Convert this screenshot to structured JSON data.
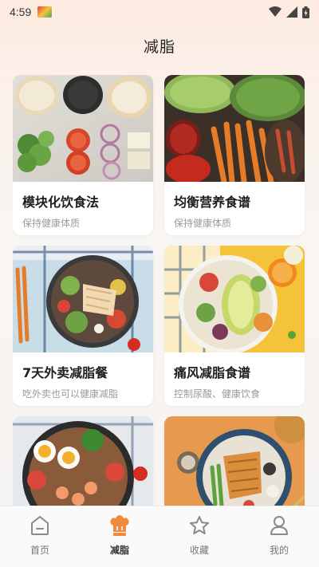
{
  "status": {
    "time": "4:59"
  },
  "header": {
    "title": "减脂"
  },
  "cards": [
    {
      "title": "模块化饮食法",
      "subtitle": "保持健康体质"
    },
    {
      "title": "均衡营养食谱",
      "subtitle": "保持健康体质"
    },
    {
      "title": "7天外卖减脂餐",
      "subtitle": "吃外卖也可以健康减脂"
    },
    {
      "title": "痛风减脂食谱",
      "subtitle": "控制尿酸、健康饮食"
    },
    {
      "title": "",
      "subtitle": ""
    },
    {
      "title": "",
      "subtitle": ""
    }
  ],
  "tabs": [
    {
      "label": "首页",
      "icon": "home-icon"
    },
    {
      "label": "减脂",
      "icon": "chef-hat-icon",
      "active": true
    },
    {
      "label": "收藏",
      "icon": "star-icon"
    },
    {
      "label": "我的",
      "icon": "person-icon"
    }
  ],
  "colors": {
    "accent": "#f08a3c",
    "tab_inactive": "#777777",
    "card_bg": "#ffffff"
  }
}
